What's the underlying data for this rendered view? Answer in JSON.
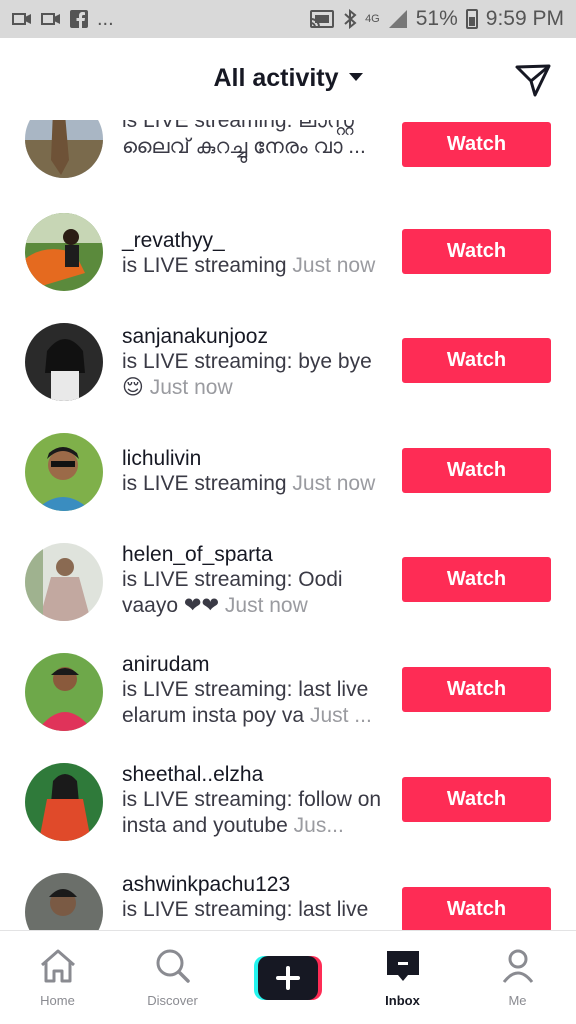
{
  "status_bar": {
    "left_dots": "...",
    "network": "4G",
    "battery": "51%",
    "time": "9:59 PM"
  },
  "header": {
    "title": "All activity"
  },
  "items": [
    {
      "username": "",
      "description": "is LIVE streaming: ലാസ്റ്റ് ലൈവ് കുറച്ചു നേരം വാ ...",
      "time": "",
      "button": "Watch"
    },
    {
      "username": "_revathyy_",
      "description": "is LIVE streaming ",
      "time": "Just now",
      "button": "Watch"
    },
    {
      "username": "sanjanakunjooz",
      "description": "is LIVE streaming: bye bye 😌 ",
      "time": "Just now",
      "button": "Watch"
    },
    {
      "username": "lichulivin",
      "description": "is LIVE streaming ",
      "time": "Just now",
      "button": "Watch"
    },
    {
      "username": "helen_of_sparta",
      "description": "is LIVE streaming: Oodi vaayo ❤❤ ",
      "time": "Just now",
      "button": "Watch"
    },
    {
      "username": "anirudam",
      "description": "is LIVE streaming: last live elarum insta poy va ",
      "time": "Just ...",
      "button": "Watch"
    },
    {
      "username": "sheethal..elzha",
      "description": "is LIVE streaming: follow on insta and youtube ",
      "time": "Jus...",
      "button": "Watch"
    },
    {
      "username": "ashwinkpachu123",
      "description": "is LIVE streaming: last live",
      "time": "",
      "button": "Watch"
    }
  ],
  "nav": {
    "home": "Home",
    "discover": "Discover",
    "inbox": "Inbox",
    "me": "Me"
  },
  "colors": {
    "accent": "#fe2c55",
    "text": "#161823",
    "muted": "#9a9ba0"
  }
}
